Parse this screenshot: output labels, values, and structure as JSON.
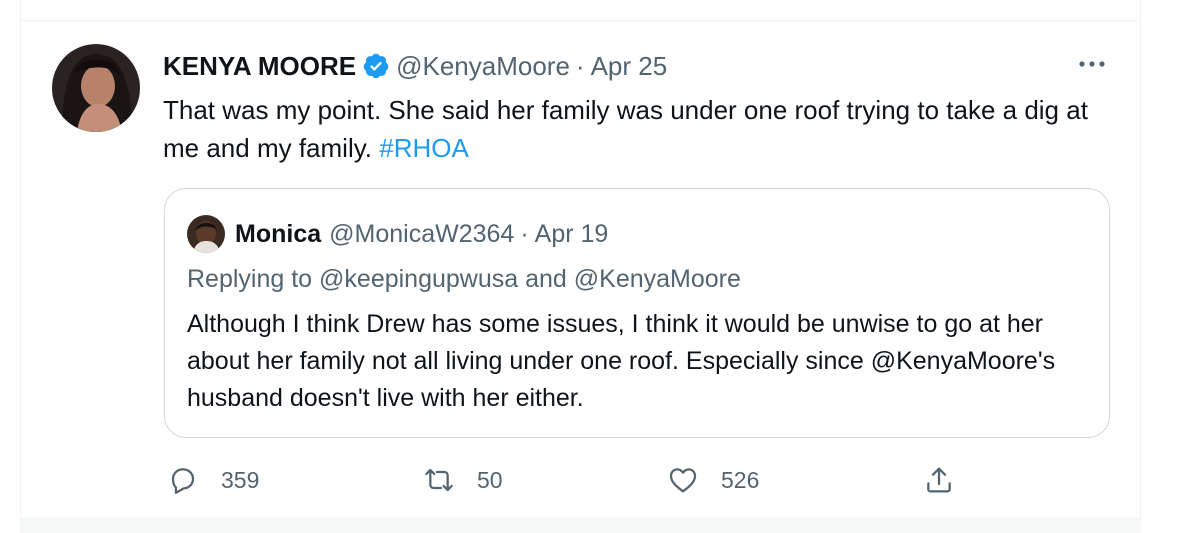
{
  "tweet": {
    "author_name": "KENYA MOORE",
    "handle": "@KenyaMoore",
    "separator": "·",
    "date": "Apr 25",
    "text": "That was my point.  She said her family was under one roof trying to take a dig at me and my family. ",
    "hashtag": "#RHOA",
    "more_label": "•••"
  },
  "quote": {
    "author_name": "Monica",
    "handle": "@MonicaW2364",
    "separator": "·",
    "date": "Apr 19",
    "replying_prefix": "Replying to",
    "replying_to_1": "@keepingupwusa",
    "replying_joiner": "and",
    "replying_to_2": "@KenyaMoore",
    "text": "Although I think Drew has some issues, I think it would be unwise to go at her about her family not all living under one roof. Especially since @KenyaMoore's husband doesn't live with her either."
  },
  "actions": {
    "reply_count": "359",
    "retweet_count": "50",
    "like_count": "526"
  },
  "colors": {
    "accent": "#1d9bf0",
    "secondary_text": "#536471",
    "border": "#cfd9de",
    "verified": "#1d9bf0"
  },
  "icons": [
    "verified-badge-icon",
    "more-options-icon",
    "reply-icon",
    "retweet-icon",
    "like-icon",
    "share-icon"
  ]
}
